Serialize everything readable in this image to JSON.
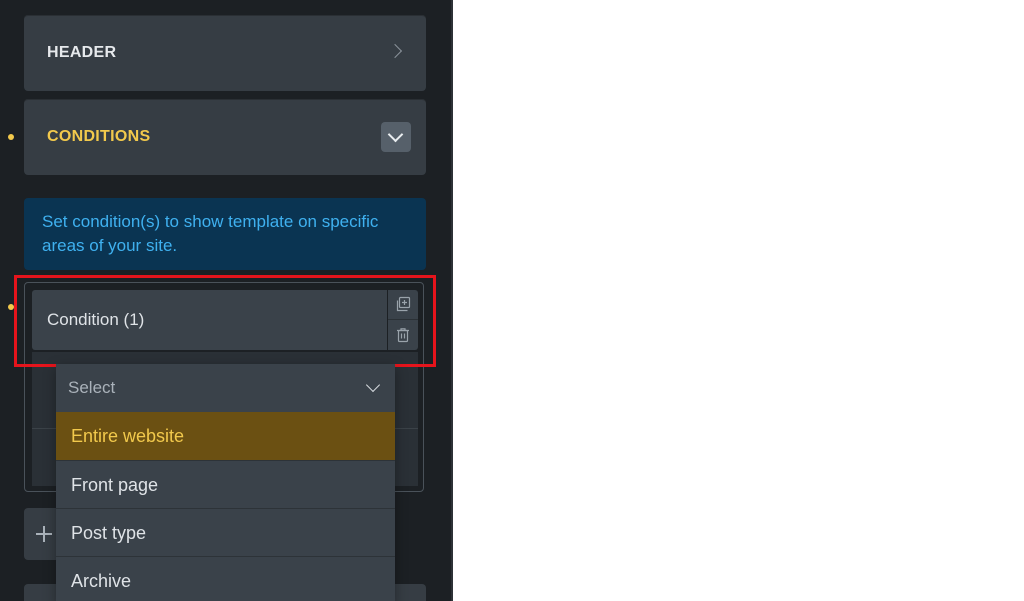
{
  "sidebar": {
    "sections": [
      {
        "title": "HEADER",
        "state": "collapsed"
      },
      {
        "title": "CONDITIONS",
        "state": "expanded",
        "accent": "#f2c94c"
      }
    ],
    "info_text": "Set condition(s) to show template on specific areas of your site.",
    "condition": {
      "title": "Condition (1)",
      "actions": [
        "duplicate-icon",
        "trash-icon"
      ]
    },
    "select": {
      "placeholder": "Select",
      "options": [
        {
          "label": "Entire website",
          "selected": true
        },
        {
          "label": "Front page",
          "selected": false
        },
        {
          "label": "Post type",
          "selected": false
        },
        {
          "label": "Archive",
          "selected": false
        }
      ]
    }
  },
  "colors": {
    "panel_bg": "#1c2024",
    "section_bg": "#363d44",
    "accent": "#f2c94c",
    "info_bg": "#0a3452",
    "info_text": "#3fb1f0",
    "highlight": "#e6141c",
    "selected_option_bg": "#6b5012"
  }
}
